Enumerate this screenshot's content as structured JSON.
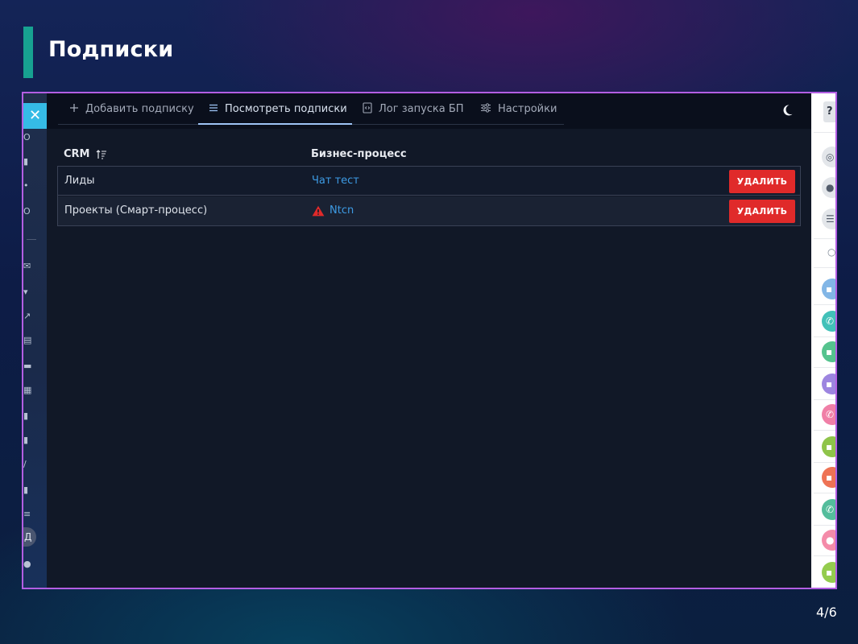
{
  "slide": {
    "title": "Подписки",
    "page_number": "4/6"
  },
  "colors": {
    "accent_bar": "#17a291",
    "frame_border": "#b35ee3",
    "tab_active": "#9ec4f5",
    "link": "#3d9be4",
    "delete_button": "#e02a2a",
    "warning": "#e02a2a"
  },
  "portal": {
    "close_icon": "close-icon",
    "left_avatar_letter": "Д",
    "right_help_label": "?"
  },
  "app": {
    "tabs": [
      {
        "label": "Добавить подписку",
        "icon": "plus-icon",
        "active": false
      },
      {
        "label": "Посмотреть подписки",
        "icon": "list-icon",
        "active": true
      },
      {
        "label": "Лог запуска БП",
        "icon": "code-file-icon",
        "active": false
      },
      {
        "label": "Настройки",
        "icon": "sliders-icon",
        "active": false
      }
    ],
    "theme_toggle_icon": "moon-icon",
    "table": {
      "columns": [
        "CRM",
        "Бизнес-процесс"
      ],
      "sort_icon": "sort-ascending-icon",
      "rows": [
        {
          "crm": "Лиды",
          "process": "Чат тест",
          "warning": false,
          "action": "УДАЛИТЬ"
        },
        {
          "crm": "Проекты (Смарт-процесс)",
          "process": "Ntcn",
          "warning": true,
          "action": "УДАЛИТЬ"
        }
      ]
    }
  }
}
